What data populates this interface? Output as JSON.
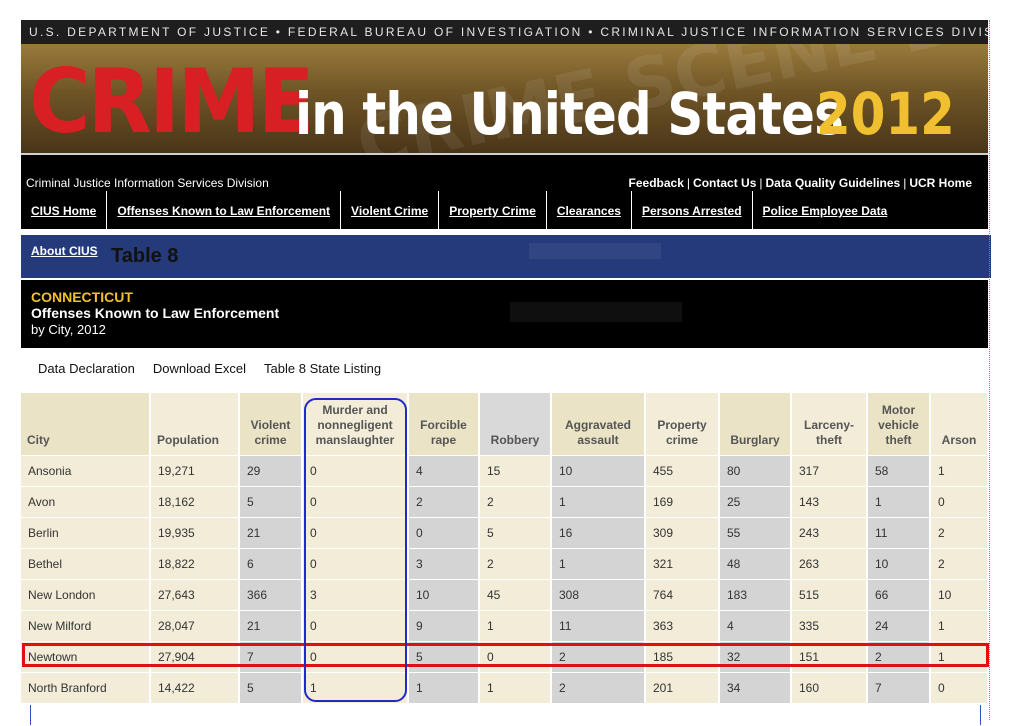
{
  "header": {
    "top_strip": "U.S. DEPARTMENT OF JUSTICE • FEDERAL BUREAU OF INVESTIGATION • CRIMINAL JUSTICE INFORMATION SERVICES DIVISION",
    "banner_crime": "CRIME",
    "banner_mid": "in the United States",
    "banner_year": "2012",
    "banner_bg_text": "CRIME SCENE DO"
  },
  "subheader": {
    "division": "Criminal Justice Information Services Division",
    "util_links": [
      "Feedback",
      "Contact Us",
      "Data Quality Guidelines",
      "UCR Home"
    ],
    "separator": "|"
  },
  "nav": {
    "items": [
      "CIUS Home",
      "Offenses Known to Law Enforcement",
      "Violent Crime",
      "Property Crime",
      "Clearances",
      "Persons Arrested",
      "Police Employee Data"
    ]
  },
  "page": {
    "about_link": "About CIUS",
    "table_title": "Table 8",
    "state": "CONNECTICUT",
    "subtitle": "Offenses Known to Law Enforcement",
    "byline": "by City, 2012"
  },
  "page_links": [
    "Data Declaration",
    "Download Excel",
    "Table 8 State Listing"
  ],
  "table": {
    "columns": [
      "City",
      "Population",
      "Violent crime",
      "Murder and nonnegligent manslaughter",
      "Forcible rape",
      "Robbery",
      "Aggravated assault",
      "Property crime",
      "Burglary",
      "Larceny-theft",
      "Motor vehicle theft",
      "Arson"
    ],
    "rows": [
      [
        "Ansonia",
        "19,271",
        "29",
        "0",
        "4",
        "15",
        "10",
        "455",
        "80",
        "317",
        "58",
        "1"
      ],
      [
        "Avon",
        "18,162",
        "5",
        "0",
        "2",
        "2",
        "1",
        "169",
        "25",
        "143",
        "1",
        "0"
      ],
      [
        "Berlin",
        "19,935",
        "21",
        "0",
        "0",
        "5",
        "16",
        "309",
        "55",
        "243",
        "11",
        "2"
      ],
      [
        "Bethel",
        "18,822",
        "6",
        "0",
        "3",
        "2",
        "1",
        "321",
        "48",
        "263",
        "10",
        "2"
      ],
      [
        "New London",
        "27,643",
        "366",
        "3",
        "10",
        "45",
        "308",
        "764",
        "183",
        "515",
        "66",
        "10"
      ],
      [
        "New Milford",
        "28,047",
        "21",
        "0",
        "9",
        "1",
        "11",
        "363",
        "4",
        "335",
        "24",
        "1"
      ],
      [
        "Newtown",
        "27,904",
        "7",
        "0",
        "5",
        "0",
        "2",
        "185",
        "32",
        "151",
        "2",
        "1"
      ],
      [
        "North Branford",
        "14,422",
        "5",
        "1",
        "1",
        "1",
        "2",
        "201",
        "34",
        "160",
        "7",
        "0"
      ]
    ]
  },
  "colors": {
    "banner_red": "#d81f23",
    "banner_gold": "#f0c030",
    "nav_bar": "#000000",
    "title_bar": "#243a7a",
    "highlight_row": "#e01010",
    "highlight_column": "#1f2ac8"
  }
}
